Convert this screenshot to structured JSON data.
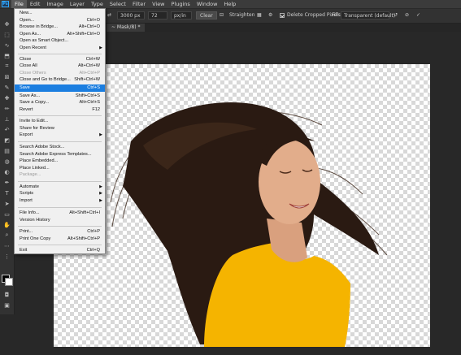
{
  "menubar": {
    "logo": "Ps",
    "items": [
      "File",
      "Edit",
      "Image",
      "Layer",
      "Type",
      "Select",
      "Filter",
      "View",
      "Plugins",
      "Window",
      "Help"
    ]
  },
  "options": {
    "width_value": "3000 px",
    "resolution_value": "72",
    "units": "px/in",
    "clear_label": "Clear",
    "straighten_label": "Straighten",
    "delete_cropped_label": "Delete Cropped Pixels",
    "fill_label": "Fill:",
    "fill_value": "Transparent (default)"
  },
  "document": {
    "tab_title": "~ Mask/8) *"
  },
  "file_menu": {
    "items": [
      {
        "label": "New...",
        "shortcut": ""
      },
      {
        "label": "Open...",
        "shortcut": "Ctrl+O"
      },
      {
        "label": "Browse in Bridge...",
        "shortcut": "Alt+Ctrl+O"
      },
      {
        "label": "Open As...",
        "shortcut": "Alt+Shift+Ctrl+O"
      },
      {
        "label": "Open as Smart Object...",
        "shortcut": ""
      },
      {
        "label": "Open Recent",
        "shortcut": ""
      },
      {
        "label": "Close",
        "shortcut": "Ctrl+W"
      },
      {
        "label": "Close All",
        "shortcut": "Alt+Ctrl+W"
      },
      {
        "label": "Close Others",
        "shortcut": "Alt+Ctrl+P"
      },
      {
        "label": "Close and Go to Bridge...",
        "shortcut": "Shift+Ctrl+W"
      },
      {
        "label": "Save",
        "shortcut": "Ctrl+S"
      },
      {
        "label": "Save As...",
        "shortcut": "Shift+Ctrl+S"
      },
      {
        "label": "Save a Copy...",
        "shortcut": "Alt+Ctrl+S"
      },
      {
        "label": "Revert",
        "shortcut": "F12"
      },
      {
        "label": "Invite to Edit...",
        "shortcut": ""
      },
      {
        "label": "Share for Review",
        "shortcut": ""
      },
      {
        "label": "Export",
        "shortcut": ""
      },
      {
        "label": "Search Adobe Stock...",
        "shortcut": ""
      },
      {
        "label": "Search Adobe Express Templates...",
        "shortcut": ""
      },
      {
        "label": "Place Embedded...",
        "shortcut": ""
      },
      {
        "label": "Place Linked...",
        "shortcut": ""
      },
      {
        "label": "Package...",
        "shortcut": ""
      },
      {
        "label": "Automate",
        "shortcut": ""
      },
      {
        "label": "Scripts",
        "shortcut": ""
      },
      {
        "label": "Import",
        "shortcut": ""
      },
      {
        "label": "File Info...",
        "shortcut": "Alt+Shift+Ctrl+I"
      },
      {
        "label": "Version History",
        "shortcut": ""
      },
      {
        "label": "Print...",
        "shortcut": "Ctrl+P"
      },
      {
        "label": "Print One Copy",
        "shortcut": "Alt+Shift+Ctrl+P"
      },
      {
        "label": "Exit",
        "shortcut": "Ctrl+Q"
      }
    ]
  },
  "colors": {
    "highlight": "#1b7ee0",
    "shirt": "#f5b400",
    "hair": "#2a1a12"
  }
}
